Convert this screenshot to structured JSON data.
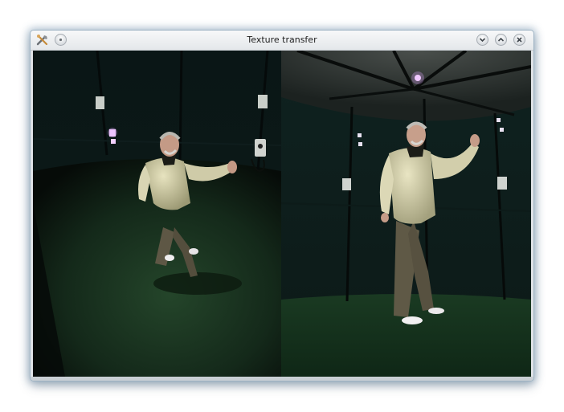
{
  "window": {
    "title": "Texture transfer"
  },
  "titlebar": {
    "buttons": [
      {
        "name": "menu",
        "icon": "circle-dot-icon"
      },
      {
        "name": "minimize",
        "icon": "chevron-down-icon"
      },
      {
        "name": "maximize",
        "icon": "chevron-up-icon"
      },
      {
        "name": "close",
        "icon": "close-icon"
      }
    ]
  },
  "images": [
    {
      "name": "source-render",
      "description_icon": "photo-icon"
    },
    {
      "name": "target-render",
      "description_icon": "photo-icon"
    }
  ],
  "colors": {
    "titlebar_top": "#f7f8f9",
    "titlebar_bottom": "#e4e7ea",
    "window_glow": "#9db2c3",
    "floor_green": "#1c3a22",
    "studio_dark": "#0d1a17"
  }
}
